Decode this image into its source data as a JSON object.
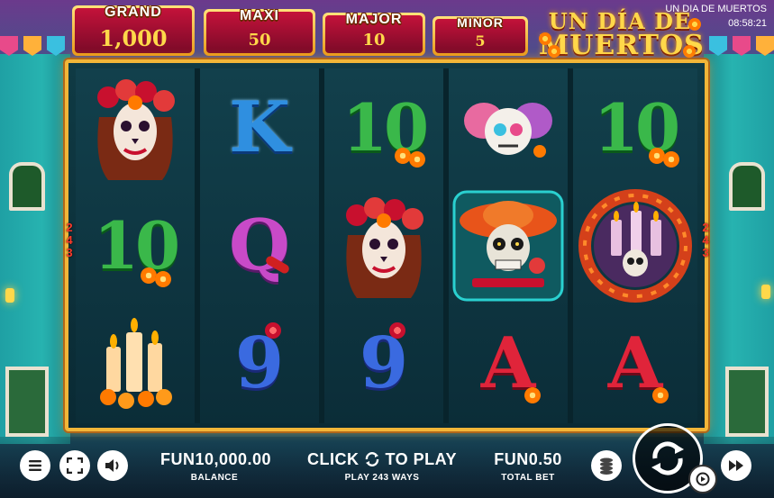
{
  "game": {
    "title": "UN DIA DE MUERTOS",
    "clock": "08:58:21",
    "logo_line1": "UN DÍA DE",
    "logo_line2": "MUERTOS"
  },
  "jackpots": [
    {
      "label": "GRAND",
      "value": "1,000"
    },
    {
      "label": "MAXI",
      "value": "50"
    },
    {
      "label": "MAJOR",
      "value": "10"
    },
    {
      "label": "MINOR",
      "value": "5"
    }
  ],
  "ways_indicator": [
    "2",
    "4",
    "3"
  ],
  "reels": [
    [
      "catrina",
      "10",
      "candles"
    ],
    [
      "K",
      "Q",
      "9"
    ],
    [
      "10",
      "catrina",
      "9"
    ],
    [
      "sugar-skulls",
      "mariachi-skull",
      "A"
    ],
    [
      "10",
      "candle-skull-wreath",
      "A"
    ]
  ],
  "symbol_labels": {
    "K": "K",
    "Q": "Q",
    "A": "A",
    "9": "9",
    "10": "10"
  },
  "bottom": {
    "balance_value": "FUN10,000.00",
    "balance_label": "BALANCE",
    "click_text_1": "CLICK",
    "click_text_2": "TO PLAY",
    "play_ways": "PLAY 243 WAYS",
    "bet_value": "FUN0.50",
    "bet_label": "TOTAL BET"
  },
  "icons": {
    "menu": "menu-icon",
    "fullscreen": "fullscreen-icon",
    "sound": "speaker-icon",
    "coins": "coin-stack-icon",
    "spin": "spin-arrows-icon",
    "autoplay": "autoplay-icon",
    "turbo": "fast-forward-icon"
  },
  "colors": {
    "frame_gold": "#f2b638",
    "jackpot_red": "#c4123a",
    "ways_red": "#ff3a2a"
  }
}
